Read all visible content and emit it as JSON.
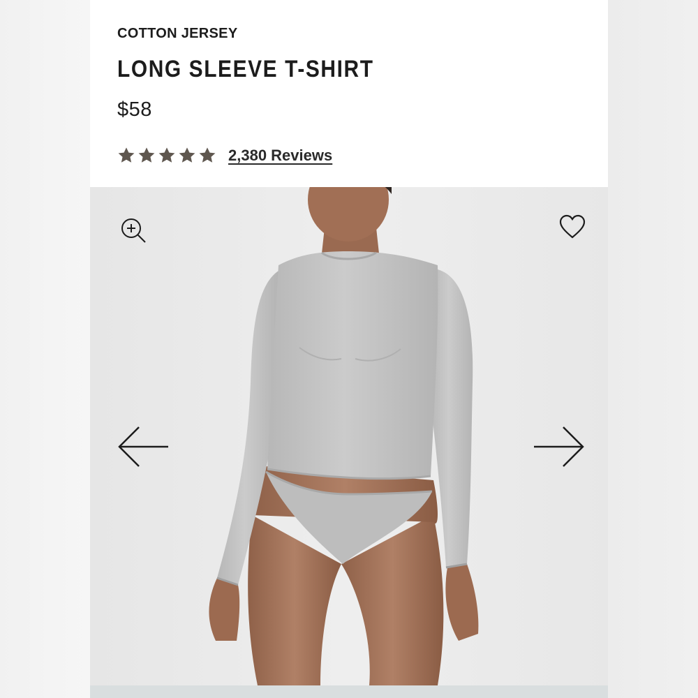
{
  "product": {
    "collection": "COTTON JERSEY",
    "name": "LONG SLEEVE T-SHIRT",
    "price": "$58",
    "rating": {
      "stars": 5,
      "star_color": "#5f574f",
      "reviews_label": "2,380 Reviews"
    }
  },
  "gallery": {
    "image_alt": "Model wearing a heather grey long sleeve t-shirt",
    "controls": {
      "zoom_icon": "zoom-in-icon",
      "favorite_icon": "heart-icon",
      "prev_icon": "arrow-left-icon",
      "next_icon": "arrow-right-icon"
    }
  },
  "colors": {
    "text": "#1c1c1c",
    "garment": "#c4c4c4",
    "background": "#e8e8e8",
    "skin": "#a9785c"
  }
}
